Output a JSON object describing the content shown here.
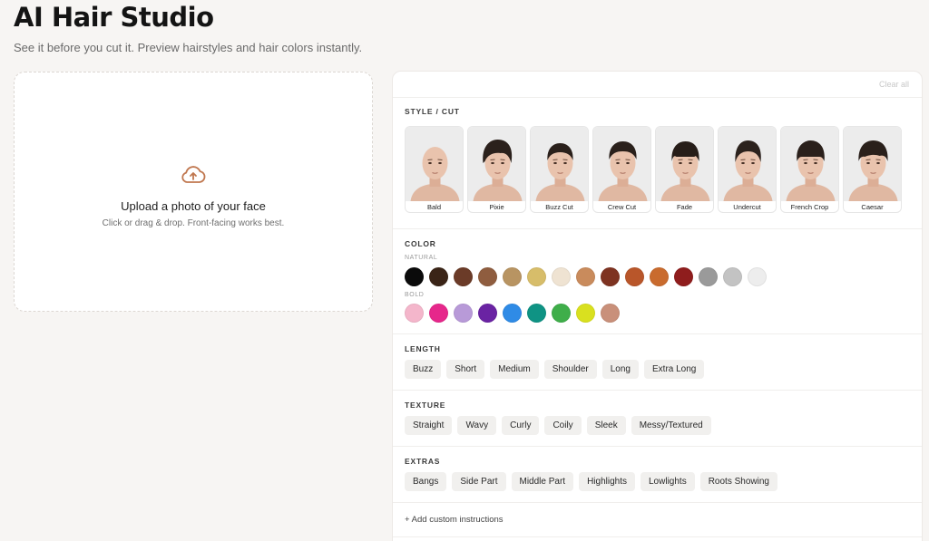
{
  "header": {
    "title": "AI Hair Studio",
    "subtitle": "See it before you cut it. Preview hairstyles and hair colors instantly."
  },
  "upload": {
    "icon": "cloud-upload-icon",
    "title": "Upload a photo of your face",
    "hint": "Click or drag & drop. Front-facing works best."
  },
  "panel": {
    "clear_all": "Clear all",
    "style": {
      "title": "STYLE / CUT",
      "items": [
        {
          "label": "Bald",
          "hair": "#d9b6a6"
        },
        {
          "label": "Pixie",
          "hair": "#2b211c"
        },
        {
          "label": "Buzz Cut",
          "hair": "#2a201b"
        },
        {
          "label": "Crew Cut",
          "hair": "#2a201b"
        },
        {
          "label": "Fade",
          "hair": "#261d18"
        },
        {
          "label": "Undercut",
          "hair": "#2c221d"
        },
        {
          "label": "French Crop",
          "hair": "#2a201b"
        },
        {
          "label": "Caesar",
          "hair": "#2a201b"
        }
      ]
    },
    "color": {
      "title": "COLOR",
      "natural_label": "NATURAL",
      "natural": [
        "#0b0b0b",
        "#3a2417",
        "#6b3b28",
        "#8f5d3f",
        "#b89462",
        "#d7bd6a",
        "#efe3d2",
        "#c98b5c",
        "#7e3321",
        "#b9562a",
        "#c96b2e",
        "#8f1d1d",
        "#9a9a9a",
        "#c3c3c3",
        "#ededed"
      ],
      "bold_label": "BOLD",
      "bold": [
        "#f4b6cb",
        "#e6278b",
        "#b89ad8",
        "#6a23a3",
        "#2f8be6",
        "#0f9384",
        "#3fae4a",
        "#d9e01f",
        "#c9907a"
      ]
    },
    "length": {
      "title": "LENGTH",
      "options": [
        "Buzz",
        "Short",
        "Medium",
        "Shoulder",
        "Long",
        "Extra Long"
      ]
    },
    "texture": {
      "title": "TEXTURE",
      "options": [
        "Straight",
        "Wavy",
        "Curly",
        "Coily",
        "Sleek",
        "Messy/Textured"
      ]
    },
    "extras": {
      "title": "EXTRAS",
      "options": [
        "Bangs",
        "Side Part",
        "Middle Part",
        "Highlights",
        "Lowlights",
        "Roots Showing"
      ]
    },
    "custom_instructions": "+ Add custom instructions"
  }
}
